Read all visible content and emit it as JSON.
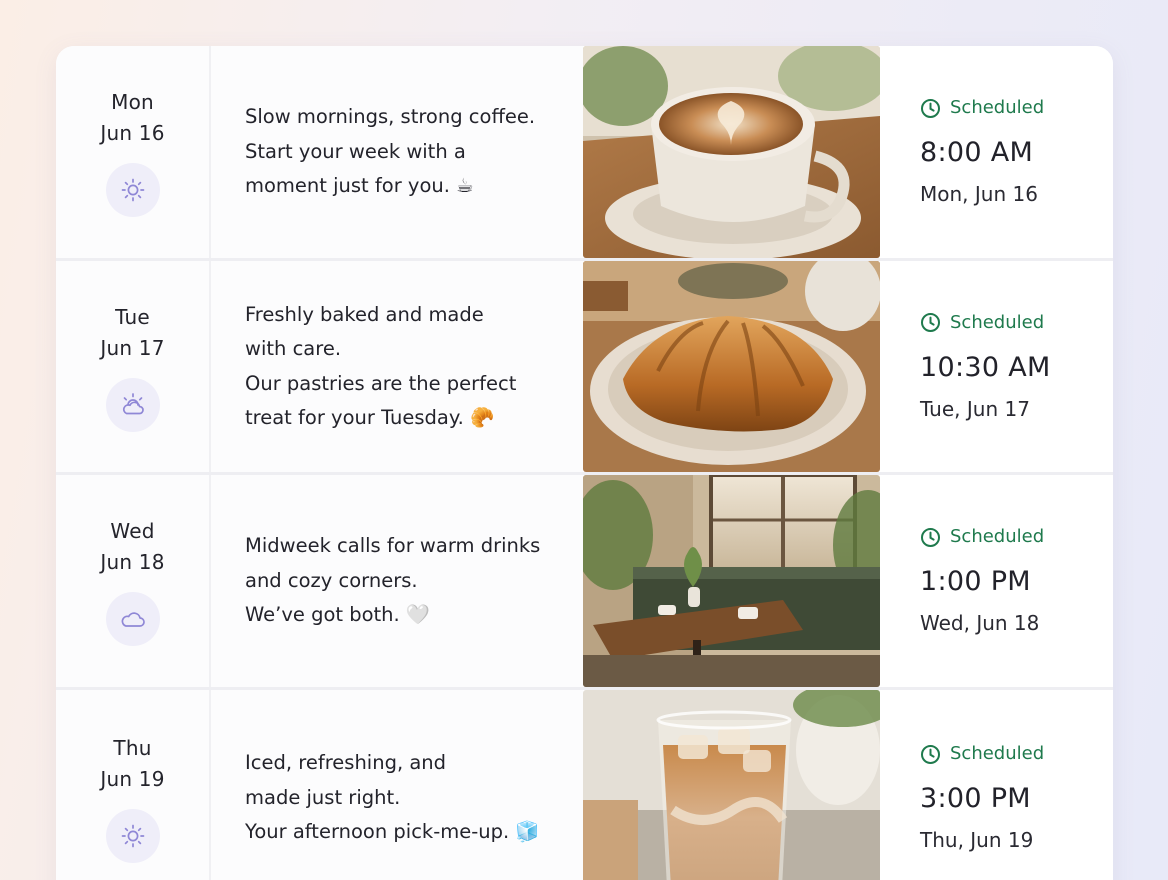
{
  "rows": [
    {
      "day": "Mon",
      "date": "Jun 16",
      "weather_icon": "sun-icon",
      "lines": [
        "Slow mornings, strong coffee.",
        "Start your week with a",
        "moment just for you. ☕"
      ],
      "photo": "latte-coffee-cup-photo",
      "status": "Scheduled",
      "time": "8:00 AM",
      "scheduled_date": "Mon, Jun 16"
    },
    {
      "day": "Tue",
      "date": "Jun 17",
      "weather_icon": "partly-cloudy-icon",
      "lines": [
        "Freshly baked and made",
        "with care.",
        "Our pastries are the perfect",
        "treat for your Tuesday. 🥐"
      ],
      "photo": "croissant-plate-photo",
      "status": "Scheduled",
      "time": "10:30 AM",
      "scheduled_date": "Tue, Jun 17"
    },
    {
      "day": "Wed",
      "date": "Jun 18",
      "weather_icon": "cloud-icon",
      "lines": [
        "Midweek calls for warm drinks",
        "and cozy corners.",
        "We’ve got both. 🤍"
      ],
      "photo": "cafe-interior-photo",
      "status": "Scheduled",
      "time": "1:00 PM",
      "scheduled_date": "Wed, Jun 18"
    },
    {
      "day": "Thu",
      "date": "Jun 19",
      "weather_icon": "sun-icon",
      "lines": [
        "Iced, refreshing, and",
        "made just right.",
        "Your afternoon pick-me-up. 🧊"
      ],
      "photo": "iced-latte-glass-photo",
      "status": "Scheduled",
      "time": "3:00 PM",
      "scheduled_date": "Thu, Jun 19"
    }
  ],
  "colors": {
    "status_green": "#1f7a4d",
    "weather_icon": "#8f87d6",
    "weather_bg": "#efeef9"
  }
}
